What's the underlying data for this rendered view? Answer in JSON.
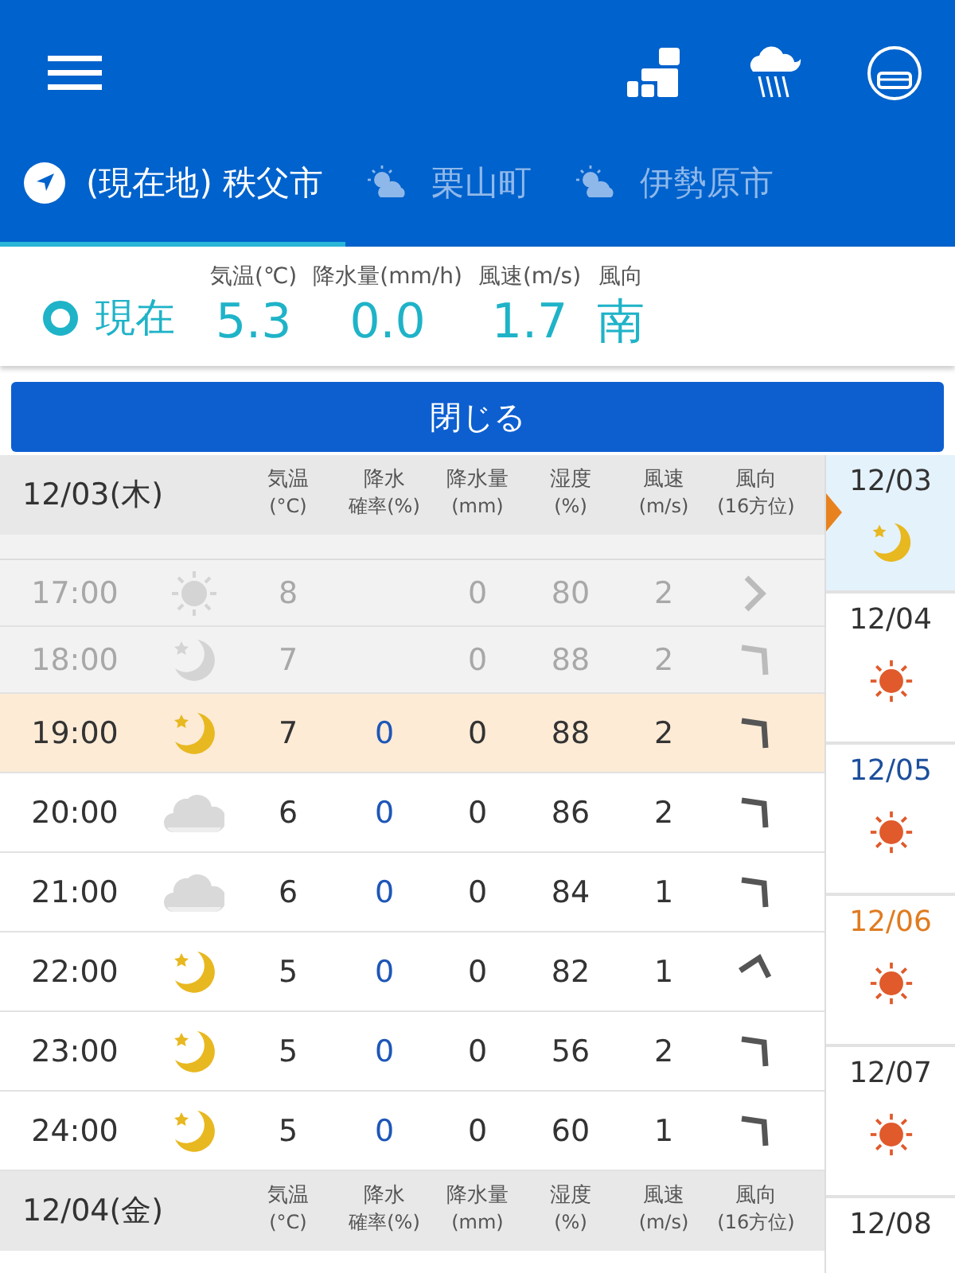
{
  "location_tabs": [
    {
      "label": "(現在地) 秩父市",
      "selected": true
    },
    {
      "label": "栗山町",
      "selected": false
    },
    {
      "label": "伊勢原市",
      "selected": false
    }
  ],
  "current": {
    "label": "現在",
    "readings": [
      {
        "label": "気温(℃)",
        "value": "5.3"
      },
      {
        "label": "降水量(mm/h)",
        "value": "0.0"
      },
      {
        "label": "風速(m/s)",
        "value": "1.7"
      },
      {
        "label": "風向",
        "value": "南"
      }
    ]
  },
  "close_button": "閉じる",
  "days": [
    {
      "date": "12/03",
      "weekday": "(木)",
      "columns": [
        [
          "気温",
          "(°C)"
        ],
        [
          "降水",
          "確率(%)"
        ],
        [
          "降水量",
          "(mm)"
        ],
        [
          "湿度",
          "(%)"
        ],
        [
          "風速",
          "(m/s)"
        ],
        [
          "風向",
          "(16方位)"
        ]
      ],
      "rows": [
        {
          "time": "17:00",
          "kind": "sun",
          "temp": "8",
          "mm": "0",
          "humidity": "80",
          "wind": "2",
          "wind_direction": {
            "kind": "right"
          },
          "past": true,
          "selected": false
        },
        {
          "time": "18:00",
          "kind": "moon",
          "temp": "7",
          "mm": "0",
          "humidity": "88",
          "wind": "2",
          "wind_direction": {
            "kind": "upper-right"
          },
          "past": true,
          "selected": false
        },
        {
          "time": "19:00",
          "kind": "moon",
          "temp": "7",
          "pop": "0",
          "mm": "0",
          "humidity": "88",
          "wind": "2",
          "wind_direction": {
            "kind": "upper-right"
          },
          "past": false,
          "selected": true
        },
        {
          "time": "20:00",
          "kind": "cloud",
          "temp": "6",
          "pop": "0",
          "mm": "0",
          "humidity": "86",
          "wind": "2",
          "wind_direction": {
            "kind": "upper-right"
          },
          "past": false,
          "selected": false
        },
        {
          "time": "21:00",
          "kind": "cloud",
          "temp": "6",
          "pop": "0",
          "mm": "0",
          "humidity": "84",
          "wind": "1",
          "wind_direction": {
            "kind": "upper-right"
          },
          "past": false,
          "selected": false
        },
        {
          "time": "22:00",
          "kind": "moon",
          "temp": "5",
          "pop": "0",
          "mm": "0",
          "humidity": "82",
          "wind": "1",
          "wind_direction": {
            "kind": "up"
          },
          "past": false,
          "selected": false
        },
        {
          "time": "23:00",
          "kind": "moon",
          "temp": "5",
          "pop": "0",
          "mm": "0",
          "humidity": "56",
          "wind": "2",
          "wind_direction": {
            "kind": "upper-right"
          },
          "past": false,
          "selected": false
        },
        {
          "time": "24:00",
          "kind": "moon",
          "temp": "5",
          "pop": "0",
          "mm": "0",
          "humidity": "60",
          "wind": "1",
          "wind_direction": {
            "kind": "upper-right"
          },
          "past": false,
          "selected": false
        }
      ]
    },
    {
      "date": "12/04",
      "weekday": "(金)",
      "columns": [
        [
          "気温",
          "(°C)"
        ],
        [
          "降水",
          "確率(%)"
        ],
        [
          "降水量",
          "(mm)"
        ],
        [
          "湿度",
          "(%)"
        ],
        [
          "風速",
          "(m/s)"
        ],
        [
          "風向",
          "(16方位)"
        ]
      ]
    }
  ],
  "day_list": [
    {
      "date": "12/03",
      "kind": "moon",
      "color": "#333333",
      "selected": true
    },
    {
      "date": "12/04",
      "kind": "sun",
      "color": "#333333",
      "selected": false
    },
    {
      "date": "12/05",
      "kind": "sun",
      "color": "#1d4f9c",
      "selected": false
    },
    {
      "date": "12/06",
      "kind": "sun",
      "color": "#e07b20",
      "selected": false
    },
    {
      "date": "12/07",
      "kind": "sun",
      "color": "#333333",
      "selected": false
    },
    {
      "date": "12/08",
      "color": "#333333",
      "selected": false
    }
  ]
}
